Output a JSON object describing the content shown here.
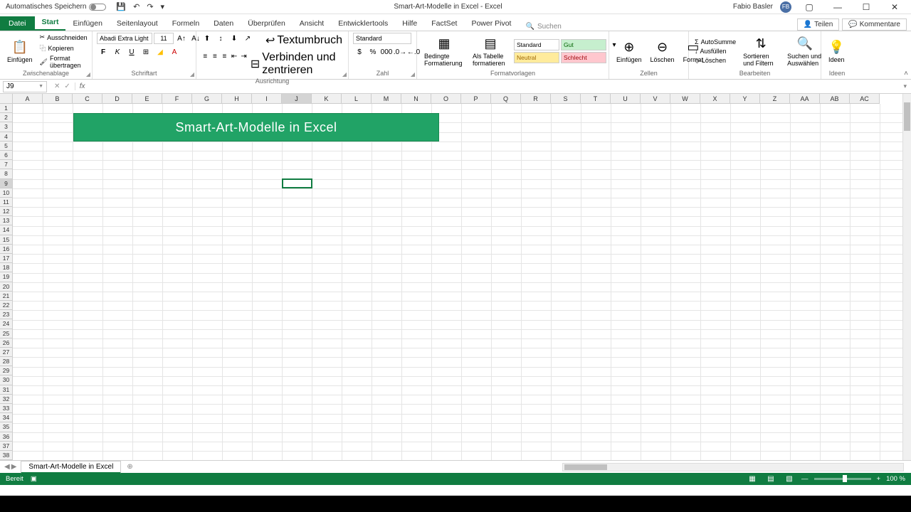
{
  "titlebar": {
    "autosave": "Automatisches Speichern",
    "doc_title": "Smart-Art-Modelle in Excel  -  Excel",
    "username": "Fabio Basler",
    "avatar": "FB"
  },
  "tabs": {
    "file": "Datei",
    "items": [
      "Start",
      "Einfügen",
      "Seitenlayout",
      "Formeln",
      "Daten",
      "Überprüfen",
      "Ansicht",
      "Entwicklertools",
      "Hilfe",
      "FactSet",
      "Power Pivot"
    ],
    "search": "Suchen",
    "share": "Teilen",
    "comments": "Kommentare"
  },
  "ribbon": {
    "clipboard": {
      "label": "Zwischenablage",
      "paste": "Einfügen",
      "cut": "Ausschneiden",
      "copy": "Kopieren",
      "format_painter": "Format übertragen"
    },
    "font": {
      "label": "Schriftart",
      "name": "Abadi Extra Light",
      "size": "11"
    },
    "alignment": {
      "label": "Ausrichtung",
      "wrap": "Textumbruch",
      "merge": "Verbinden und zentrieren"
    },
    "number": {
      "label": "Zahl",
      "format": "Standard"
    },
    "styles": {
      "label": "Formatvorlagen",
      "conditional": "Bedingte Formatierung",
      "as_table": "Als Tabelle formatieren",
      "standard": "Standard",
      "neutral": "Neutral",
      "gut": "Gut",
      "schlecht": "Schlecht"
    },
    "cells": {
      "label": "Zellen",
      "insert": "Einfügen",
      "delete": "Löschen",
      "format": "Format"
    },
    "editing": {
      "label": "Bearbeiten",
      "autosum": "AutoSumme",
      "fill": "Ausfüllen",
      "clear": "Löschen",
      "sort": "Sortieren und Filtern",
      "find": "Suchen und Auswählen"
    },
    "ideas": {
      "label": "Ideen",
      "btn": "Ideen"
    }
  },
  "formula_bar": {
    "cell_ref": "J9",
    "fx": "fx"
  },
  "sheet": {
    "columns": [
      "A",
      "B",
      "C",
      "D",
      "E",
      "F",
      "G",
      "H",
      "I",
      "J",
      "K",
      "L",
      "M",
      "N",
      "O",
      "P",
      "Q",
      "R",
      "S",
      "T",
      "U",
      "V",
      "W",
      "X",
      "Y",
      "Z",
      "AA",
      "AB",
      "AC"
    ],
    "active_col": 9,
    "active_row": 9,
    "banner_text": "Smart-Art-Modelle in Excel"
  },
  "tabs_bar": {
    "sheet_name": "Smart-Art-Modelle in Excel"
  },
  "status": {
    "ready": "Bereit",
    "zoom": "100 %"
  }
}
